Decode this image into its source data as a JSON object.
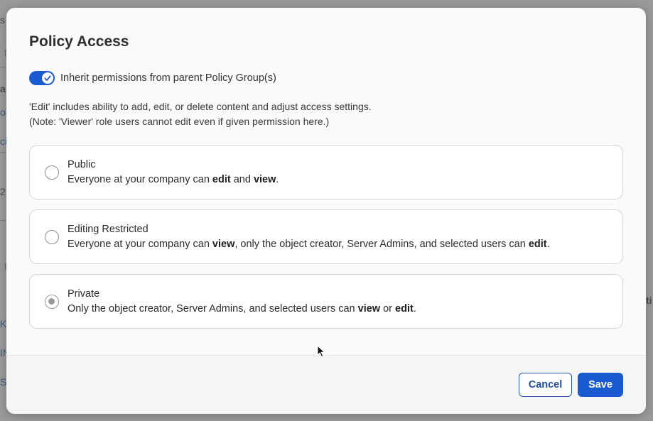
{
  "background": {
    "fragments": [
      "s",
      "t",
      "a",
      "ol",
      "ci",
      "2",
      "t",
      "K",
      "IN",
      "S",
      "ti"
    ]
  },
  "modal": {
    "title": "Policy Access",
    "inherit_toggle": {
      "checked": true,
      "label": "Inherit permissions from parent Policy Group(s)"
    },
    "note_line1": "'Edit' includes ability to add, edit, or delete content and adjust access settings.",
    "note_line2": "(Note: 'Viewer' role users cannot edit even if given permission here.)",
    "options": [
      {
        "title": "Public",
        "desc_parts": [
          "Everyone at your company can ",
          "edit",
          " and ",
          "view",
          "."
        ],
        "selected": false
      },
      {
        "title": "Editing Restricted",
        "desc_parts": [
          "Everyone at your company can ",
          "view",
          ", only the object creator, Server Admins, and selected users can ",
          "edit",
          "."
        ],
        "selected": false
      },
      {
        "title": "Private",
        "desc_parts": [
          "Only the object creator, Server Admins, and selected users can ",
          "view",
          " or ",
          "edit",
          "."
        ],
        "selected": true
      }
    ],
    "buttons": {
      "cancel": "Cancel",
      "save": "Save"
    }
  },
  "colors": {
    "primary": "#1a5ad1",
    "cancel_text": "#1e4e9a",
    "option_border": "#d4d4d4"
  },
  "icons": {
    "toggle_check": "check-icon",
    "cursor": "mouse-pointer-icon"
  }
}
